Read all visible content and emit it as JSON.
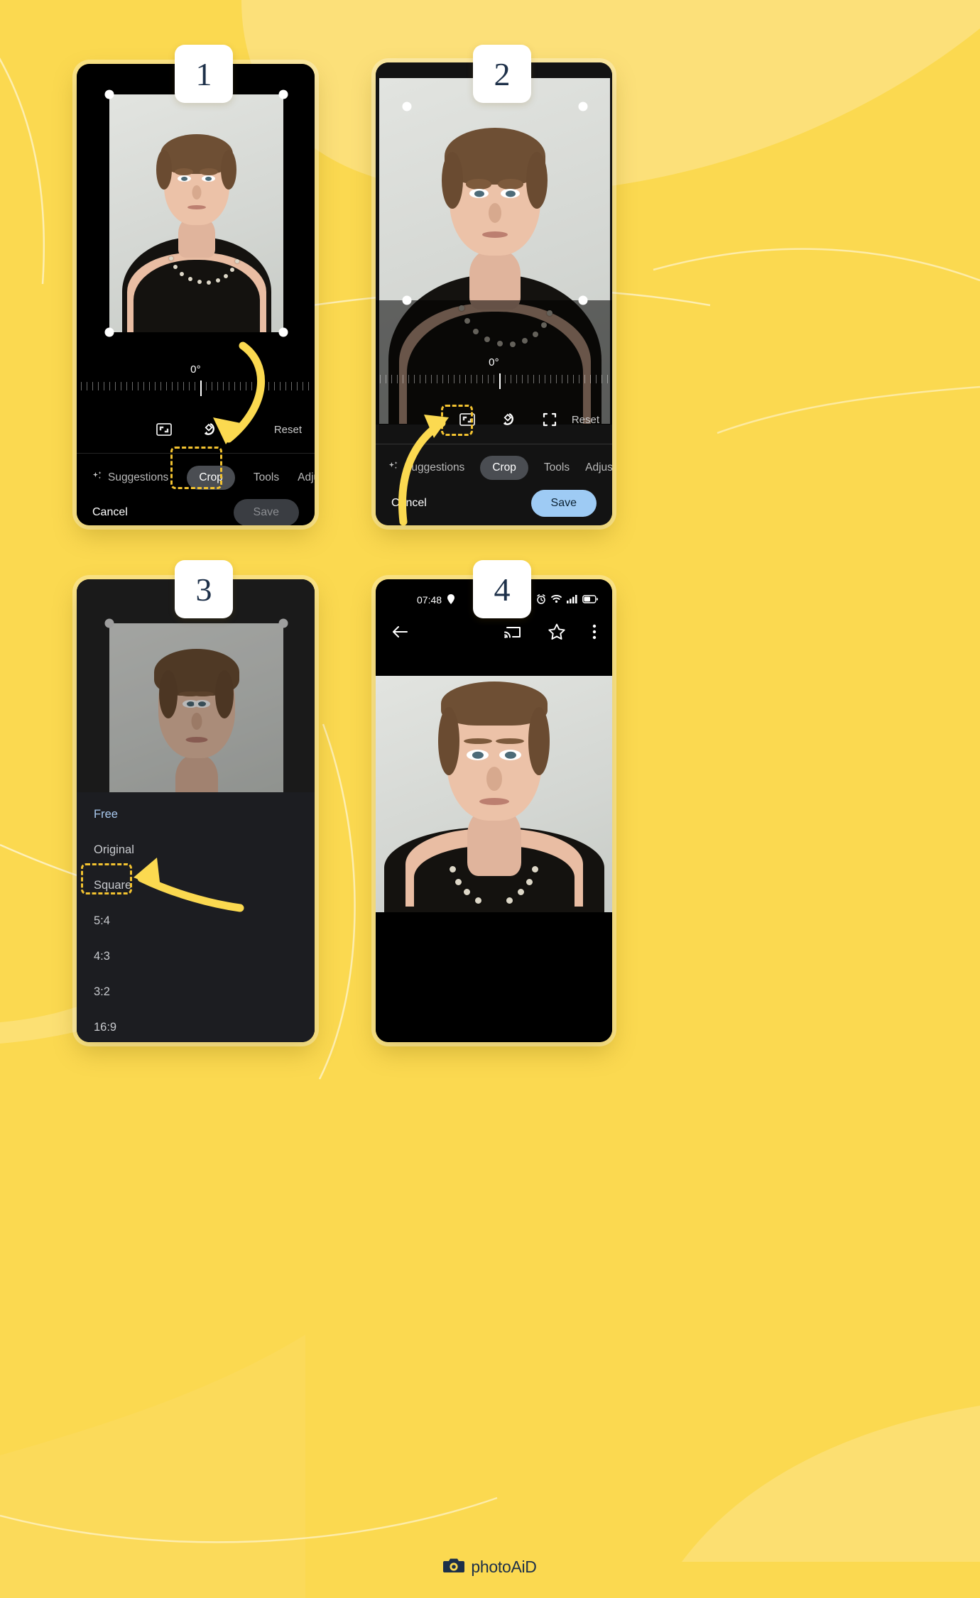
{
  "page": {
    "background_color": "#FBD950",
    "accent_color": "#F2C230",
    "badge_text_color": "#1d3049"
  },
  "footer": {
    "brand": "photoAiD",
    "camera_icon": "camera-icon"
  },
  "steps": [
    {
      "number": "1"
    },
    {
      "number": "2"
    },
    {
      "number": "3"
    },
    {
      "number": "4"
    }
  ],
  "panel1": {
    "step": "1",
    "editor": {
      "angle": "0°",
      "icons": [
        {
          "name": "aspect-ratio-icon",
          "label": "Aspect ratio"
        },
        {
          "name": "rotate-icon",
          "label": "Rotate"
        }
      ],
      "reset_label": "Reset",
      "tabs": [
        {
          "label": "Suggestions",
          "icon": "sparkle-icon",
          "active": false
        },
        {
          "label": "Crop",
          "icon": "",
          "active": true
        },
        {
          "label": "Tools",
          "icon": "",
          "active": false
        },
        {
          "label": "Adjust",
          "icon": "",
          "active": false
        }
      ],
      "cancel_label": "Cancel",
      "save_label": "Save",
      "save_enabled": false,
      "highlight_target": "Crop"
    }
  },
  "panel2": {
    "step": "2",
    "editor": {
      "angle": "0°",
      "icons": [
        {
          "name": "aspect-ratio-icon",
          "label": "Aspect ratio"
        },
        {
          "name": "rotate-icon",
          "label": "Rotate"
        },
        {
          "name": "expand-corners-icon",
          "label": "Expand"
        }
      ],
      "reset_label": "Reset",
      "tabs": [
        {
          "label": "Suggestions",
          "icon": "sparkle-icon",
          "active": false
        },
        {
          "label": "Crop",
          "icon": "",
          "active": true
        },
        {
          "label": "Tools",
          "icon": "",
          "active": false
        },
        {
          "label": "Adjust",
          "icon": "",
          "active": false
        }
      ],
      "cancel_label": "Cancel",
      "save_label": "Save",
      "save_enabled": true,
      "highlight_target": "aspect-ratio-icon"
    }
  },
  "panel3": {
    "step": "3",
    "ratio_list": {
      "items": [
        {
          "label": "Free",
          "selected": true,
          "highlighted": false
        },
        {
          "label": "Original",
          "selected": false,
          "highlighted": false
        },
        {
          "label": "Square",
          "selected": false,
          "highlighted": true
        },
        {
          "label": "5:4",
          "selected": false,
          "highlighted": false
        },
        {
          "label": "4:3",
          "selected": false,
          "highlighted": false
        },
        {
          "label": "3:2",
          "selected": false,
          "highlighted": false
        },
        {
          "label": "16:9",
          "selected": false,
          "highlighted": false
        }
      ]
    }
  },
  "panel4": {
    "step": "4",
    "statusbar": {
      "time": "07:48",
      "left_icons": [
        "location-icon"
      ],
      "right_icons": [
        "alarm-icon",
        "wifi-icon",
        "signal-icon",
        "battery-icon"
      ]
    },
    "nav": {
      "back_icon": "back-arrow-icon",
      "actions": [
        "cast-icon",
        "star-icon",
        "overflow-menu-icon"
      ]
    }
  }
}
